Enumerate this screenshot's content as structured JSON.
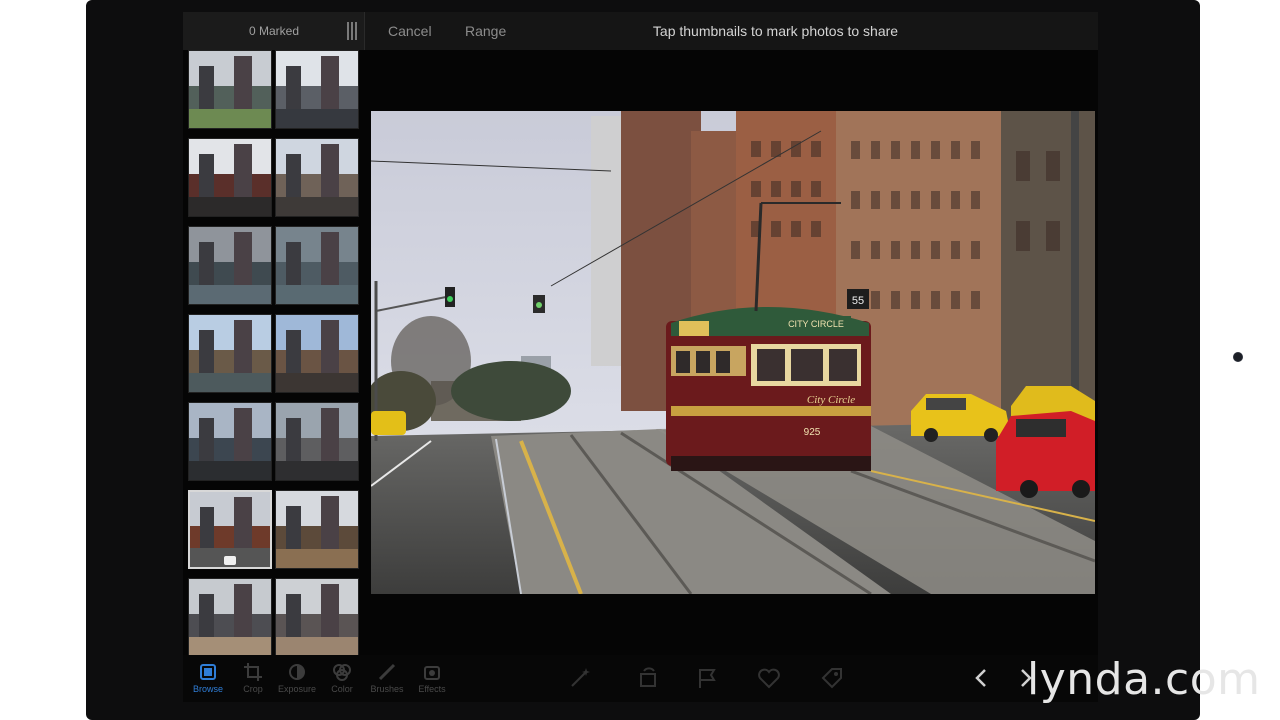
{
  "header": {
    "marked_count": "0 Marked",
    "cancel_label": "Cancel",
    "range_label": "Range",
    "instruction": "Tap thumbnails to mark photos to share"
  },
  "thumbnails": [
    {
      "sky": "#c8ccd2",
      "mid": "#52605a",
      "low": "#6d8a52"
    },
    {
      "sky": "#dfe3e8",
      "mid": "#5b5f66",
      "low": "#36393f"
    },
    {
      "sky": "#e2e4e8",
      "mid": "#5a2f2a",
      "low": "#2c2a2a"
    },
    {
      "sky": "#cfd6e0",
      "mid": "#6f6258",
      "low": "#3e3a38"
    },
    {
      "sky": "#8f949b",
      "mid": "#3f4a50",
      "low": "#5b6a73"
    },
    {
      "sky": "#77848d",
      "mid": "#4e5b63",
      "low": "#596a72"
    },
    {
      "sky": "#b9cde3",
      "mid": "#6a5a48",
      "low": "#4d5a5d"
    },
    {
      "sky": "#9fb8d8",
      "mid": "#6a5444",
      "low": "#3c3633"
    },
    {
      "sky": "#a9b5c5",
      "mid": "#3c4650",
      "low": "#2b2d30"
    },
    {
      "sky": "#9aa4ae",
      "mid": "#5e5e60",
      "low": "#2e2e30"
    },
    {
      "sky": "#c7cbd2",
      "mid": "#6e3a2a",
      "low": "#555555"
    },
    {
      "sky": "#d6d9de",
      "mid": "#5c4a3a",
      "low": "#8a6f52"
    },
    {
      "sky": "#c6cacf",
      "mid": "#4d4d52",
      "low": "#a58f77"
    },
    {
      "sky": "#cdd0d4",
      "mid": "#5a5454",
      "low": "#9b8570"
    }
  ],
  "selected_thumbnail_index": 10,
  "toolbar": {
    "browse": "Browse",
    "crop": "Crop",
    "exposure": "Exposure",
    "color": "Color",
    "brushes": "Brushes",
    "effects": "Effects"
  },
  "photo": {
    "tram_sign": "CITY CIRCLE",
    "tram_number": "925",
    "tram_script": "City Circle",
    "street_sign": "55"
  },
  "watermark": "lynda.com",
  "colors": {
    "accent": "#2f7dd6",
    "topbar_bg": "#151515",
    "tram_red": "#6b1a1c",
    "tram_green": "#2f5a3a",
    "taxi_yellow": "#e8c21a"
  }
}
